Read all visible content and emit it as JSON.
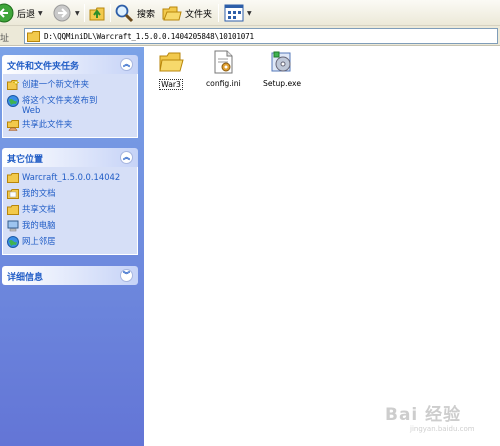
{
  "toolbar": {
    "back_label": "后退",
    "search_label": "搜索",
    "folders_label": "文件夹"
  },
  "address": {
    "label": "址",
    "path": "D:\\QQMiniDL\\Warcraft_1.5.0.0.1404205848\\10101071"
  },
  "sidebar": {
    "file_tasks": {
      "title": "文件和文件夹任务",
      "items": [
        {
          "label": "创建一个新文件夹",
          "icon": "new-folder-icon"
        },
        {
          "label": "将这个文件夹发布到",
          "label2": "Web",
          "icon": "publish-web-icon"
        },
        {
          "label": "共享此文件夹",
          "icon": "share-folder-icon"
        }
      ]
    },
    "other_places": {
      "title": "其它位置",
      "items": [
        {
          "label": "Warcraft_1.5.0.0.14042",
          "icon": "folder-icon"
        },
        {
          "label": "我的文档",
          "icon": "my-documents-icon"
        },
        {
          "label": "共享文档",
          "icon": "shared-documents-icon"
        },
        {
          "label": "我的电脑",
          "icon": "my-computer-icon"
        },
        {
          "label": "网上邻居",
          "icon": "network-places-icon"
        }
      ]
    },
    "details": {
      "title": "详细信息"
    }
  },
  "files": [
    {
      "name": "War3",
      "icon": "folder-icon",
      "selected": true
    },
    {
      "name": "config.ini",
      "icon": "ini-file-icon",
      "selected": false
    },
    {
      "name": "Setup.exe",
      "icon": "setup-exe-icon",
      "selected": false
    }
  ],
  "watermark": {
    "text": "Bai 经验",
    "sub": "jingyan.baidu.com"
  },
  "colors": {
    "sidebar_top": "#7ba2e7",
    "sidebar_bottom": "#6375d6",
    "panel_title": "#215dc6",
    "panel_body": "#d6dff7",
    "toolbar_bg": "#ece9d8"
  }
}
